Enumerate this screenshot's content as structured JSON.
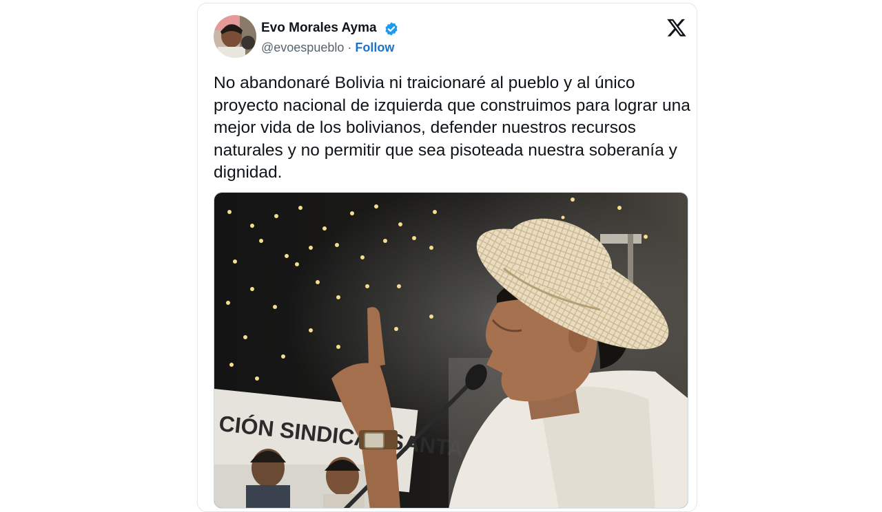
{
  "tweet": {
    "display_name": "Evo Morales Ayma",
    "handle": "@evoespueblo",
    "separator": "·",
    "follow_label": "Follow",
    "text": "No abandonaré Bolivia ni traicionaré al pueblo y al único proyecto nacional de izquierda que construimos para lograr una mejor vida de los bolivianos, defender nuestros recursos naturales y no permitir que sea pisoteada nuestra soberanía y dignidad."
  },
  "colors": {
    "follow": "#1d72c9",
    "verified": "#1d9bf0",
    "text": "#0f1419",
    "muted": "#536471"
  },
  "icons": {
    "verified": "verified-badge-icon",
    "brand": "x-logo-icon"
  },
  "banner_text": "CIÓN SINDICAL SANTA"
}
